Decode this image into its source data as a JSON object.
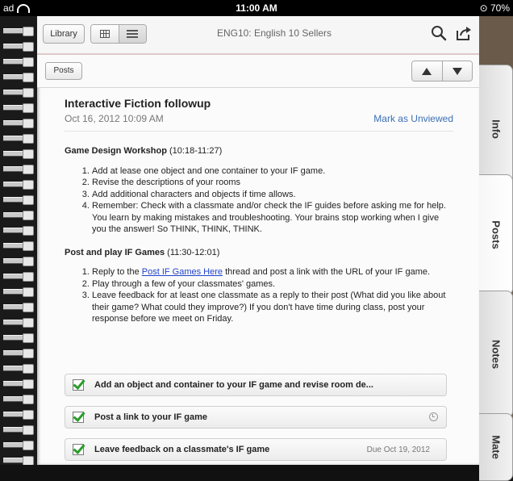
{
  "status": {
    "left": "ad",
    "time": "11:00 AM",
    "battery": "70%"
  },
  "toolbar": {
    "library_label": "Library",
    "title": "ENG10: English 10 Sellers"
  },
  "subbar": {
    "back_label": "Posts"
  },
  "post": {
    "title": "Interactive Fiction followup",
    "date": "Oct 16, 2012 10:09 AM",
    "mark_label": "Mark as Unviewed",
    "sections": [
      {
        "heading": "Game Design Workshop",
        "time": "(10:18-11:27)",
        "items": [
          "Add at lease one object and one container to your IF game.",
          "Revise the descriptions of your rooms",
          "Add additional characters and objects if time allows.",
          "Remember: Check with a classmate and/or check the IF guides before asking me for help. You learn by making mistakes and troubleshooting. Your brains stop working when I give you the answer! So THINK, THINK, THINK."
        ]
      },
      {
        "heading": "Post and play IF Games",
        "time": "(11:30-12:01)",
        "item1_pre": "Reply to the ",
        "item1_link": "Post IF Games Here",
        "item1_post": " thread and post a link with the URL of your IF game.",
        "items": [
          "Play through a few of your classmates' games.",
          "Leave feedback for at least one classmate as a reply to their post (What did you like about their game? What could they improve?) If you don't have time during class, post your response before we meet on Friday."
        ]
      }
    ]
  },
  "tasks": [
    {
      "label": "Add an object and container to your IF game and revise room de...",
      "due": ""
    },
    {
      "label": "Post a link to your IF game",
      "due": ""
    },
    {
      "label": "Leave feedback on a classmate's IF game",
      "due": "Due Oct 19, 2012"
    }
  ],
  "tabs": [
    "Info",
    "Posts",
    "Notes",
    "Mate"
  ],
  "colors": {
    "accent_link": "#3b6fb5",
    "check_green": "#2a9d2a"
  }
}
